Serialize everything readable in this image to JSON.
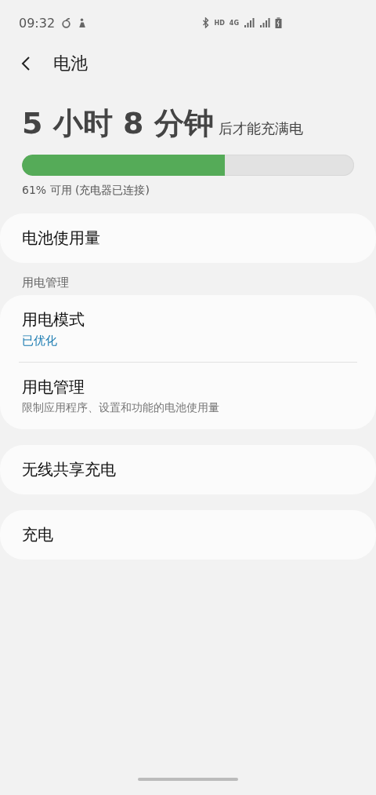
{
  "status_bar": {
    "time": "09:32",
    "labels": [
      "HD",
      "4G"
    ]
  },
  "header": {
    "title": "电池"
  },
  "charge": {
    "duration": "5 小时 8 分钟",
    "suffix": "后才能充满电",
    "level": 0.61,
    "caption": "61% 可用 (充电器已连接)"
  },
  "sections": [
    {
      "items": [
        {
          "title": "电池使用量"
        }
      ]
    },
    {
      "header": "用电管理",
      "items": [
        {
          "kind": "value",
          "title": "用电模式",
          "subtitle": "已优化"
        },
        {
          "kind": "description",
          "title": "用电管理",
          "subtitle": "限制应用程序、设置和功能的电池使用量"
        }
      ]
    },
    {
      "items": [
        {
          "title": "无线共享充电"
        }
      ]
    },
    {
      "items": [
        {
          "title": "充电"
        }
      ]
    }
  ]
}
